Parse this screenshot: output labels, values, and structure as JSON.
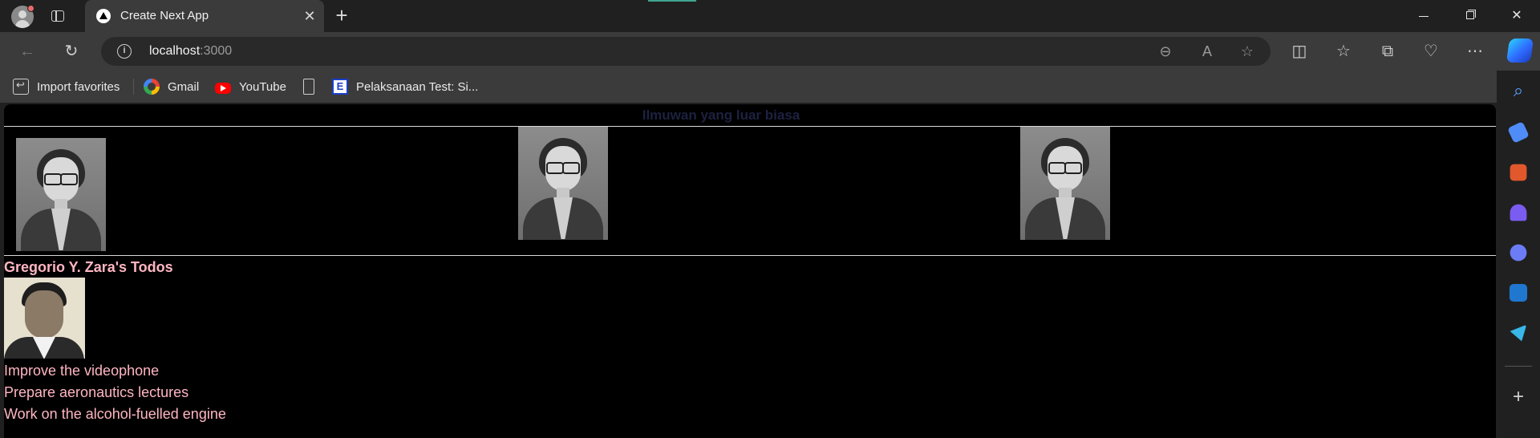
{
  "browser": {
    "tab_title": "Create Next App",
    "url_host": "localhost",
    "url_port": ":3000"
  },
  "favorites": [
    {
      "label": "Import favorites",
      "icon": "import-icon"
    },
    {
      "label": "Gmail",
      "icon": "google-icon"
    },
    {
      "label": "YouTube",
      "icon": "youtube-icon"
    },
    {
      "label": "",
      "icon": "document-icon"
    },
    {
      "label": "Pelaksanaan Test: Si...",
      "icon": "te-icon"
    }
  ],
  "page": {
    "heading": "Ilmuwan yang luar biasa",
    "gallery": [
      "scientist-portrait",
      "scientist-portrait",
      "scientist-portrait"
    ],
    "todo_title": "Gregorio Y. Zara's Todos",
    "todos": [
      "Improve the videophone",
      "Prepare aeronautics lectures",
      "Work on the alcohol-fuelled engine"
    ]
  },
  "colors": {
    "todo_text": "#ffb6c1",
    "heading_text": "#1c2240",
    "page_bg": "#000000",
    "chrome_bg": "#3b3b3b"
  }
}
